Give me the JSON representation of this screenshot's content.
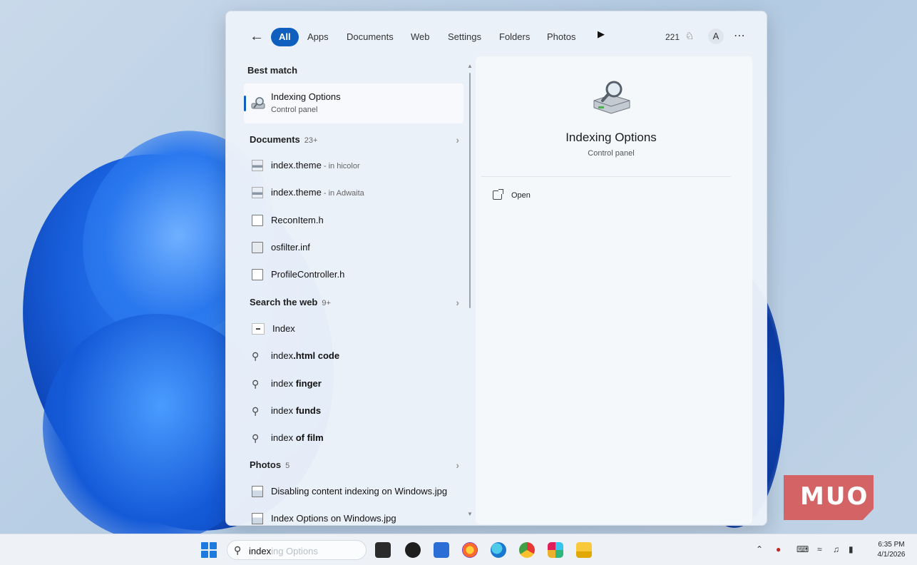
{
  "filter_bar": {
    "back_icon": "back-arrow-icon",
    "chips": [
      "All",
      "Apps",
      "Documents",
      "Web",
      "Settings",
      "Folders",
      "Photos"
    ],
    "active_chip": "All",
    "more_icon": "play-arrow-icon",
    "count": "221",
    "trophy_icon": "trophy-icon",
    "avatar_initial": "A",
    "menu_icon": "ellipsis-icon"
  },
  "results": {
    "best_match": {
      "title": "Best match",
      "item": {
        "name": "Indexing Options",
        "subtitle": "Control panel",
        "icon": "indexing-options-icon"
      }
    },
    "documents": {
      "title": "Documents",
      "count": "23+",
      "items": [
        {
          "name": "index.theme",
          "location": " - in hicolor",
          "icon": "theme-file-icon"
        },
        {
          "name": "index.theme",
          "location": " - in Adwaita",
          "icon": "theme-file-icon"
        },
        {
          "name": "ReconItem.h",
          "location": "",
          "icon": "document-icon"
        },
        {
          "name": "osfilter.inf",
          "location": "",
          "icon": "settings-file-icon"
        },
        {
          "name": "ProfileController.h",
          "location": "",
          "icon": "document-icon"
        }
      ]
    },
    "web": {
      "title": "Search the web",
      "count": "9+",
      "items": [
        {
          "prefix": "Index",
          "suffix": "",
          "icon": "web-thumbnail-icon"
        },
        {
          "prefix": "index",
          "suffix": ".html code",
          "icon": "search-icon"
        },
        {
          "prefix": "index ",
          "suffix": "finger",
          "icon": "search-icon"
        },
        {
          "prefix": "index ",
          "suffix": "funds",
          "icon": "search-icon"
        },
        {
          "prefix": "index ",
          "suffix": "of film",
          "icon": "search-icon"
        }
      ]
    },
    "photos": {
      "title": "Photos",
      "count": "5",
      "items": [
        {
          "name": "Disabling content indexing on Windows.jpg",
          "icon": "image-file-icon"
        },
        {
          "name": "Index Options on Windows.jpg",
          "icon": "image-file-icon"
        }
      ]
    }
  },
  "preview": {
    "icon": "indexing-options-large-icon",
    "title": "Indexing Options",
    "subtitle": "Control panel",
    "actions": [
      {
        "label": "Open",
        "icon": "open-external-icon"
      }
    ]
  },
  "watermark": {
    "text": "MUO"
  },
  "taskbar": {
    "search_value": "index",
    "search_ghost": "ing Options",
    "apps": [
      "terminal-icon",
      "obs-icon",
      "store-icon",
      "firefox-icon",
      "edge-icon",
      "chrome-icon",
      "slack-icon",
      "file-explorer-icon"
    ],
    "time": "6:35 PM",
    "date": "4/1/2026"
  },
  "colors": {
    "accent": "#0f5fbf",
    "taskbar": "#eef2f7",
    "watermark": "#d6595a"
  }
}
